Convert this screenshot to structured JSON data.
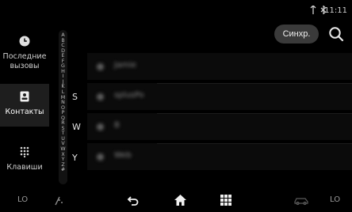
{
  "status_bar": {
    "icons": [
      "signal-icon",
      "bluetooth-icon"
    ],
    "time": "11:11"
  },
  "header": {
    "sync_label": "Синхр.",
    "search_icon": "search-icon"
  },
  "sidebar": {
    "items": [
      {
        "icon": "clock-icon",
        "label_line1": "Последние",
        "label_line2": "вызовы",
        "active": false
      },
      {
        "icon": "contact-card-icon",
        "label_line1": "Контакты",
        "label_line2": "",
        "active": true
      },
      {
        "icon": "keypad-icon",
        "label_line1": "Клавиши",
        "label_line2": "",
        "active": false
      }
    ]
  },
  "alphabet": [
    "A",
    "B",
    "C",
    "D",
    "E",
    "F",
    "G",
    "H",
    "I",
    "J",
    "K",
    "L",
    "M",
    "N",
    "O",
    "P",
    "Q",
    "R",
    "S",
    "T",
    "U",
    "V",
    "W",
    "X",
    "Y",
    "Z",
    "#"
  ],
  "contacts": {
    "groups": [
      "S",
      "W",
      "Y"
    ],
    "rows": [
      {
        "group": "",
        "name": "Jamie"
      },
      {
        "group": "S",
        "name": "splusPo"
      },
      {
        "group": "W",
        "name": "B"
      },
      {
        "group": "Y",
        "name": "Web"
      }
    ]
  },
  "bottom_bar": {
    "left_temp": "LO",
    "right_temp": "LO",
    "icons": [
      "seat-heat-icon",
      "back-icon",
      "home-icon",
      "apps-grid-icon",
      "car-icon"
    ]
  },
  "colors": {
    "background": "#000000",
    "active_sidebar": "#1e1e1e",
    "sync_button": "#3a3a3a"
  }
}
